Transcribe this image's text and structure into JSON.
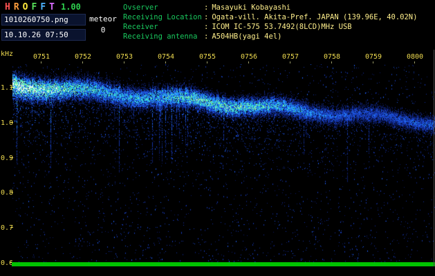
{
  "header": {
    "title": {
      "letters": [
        {
          "char": "H",
          "color": "#ff5252"
        },
        {
          "char": "R",
          "color": "#ff9e3d"
        },
        {
          "char": "O",
          "color": "#ffe93d"
        },
        {
          "char": "F",
          "color": "#57e05a"
        },
        {
          "char": "F",
          "color": "#4db2ff"
        },
        {
          "char": "T",
          "color": "#d86bff"
        }
      ],
      "version": "1.00",
      "version_color": "#2ed04e"
    },
    "filename": "1010260750.png",
    "meteor": {
      "label": "meteor",
      "count": "0"
    },
    "datetime": "10.10.26 07:50",
    "info": {
      "label_color": "#19c95e",
      "value_color": "#ffef8c",
      "separator": ":",
      "rows": [
        {
          "label": "Ovserver",
          "value": "Masayuki Kobayashi"
        },
        {
          "label": "Receiving Location",
          "value": "Ogata-vill. Akita-Pref. JAPAN (139.96E, 40.02N)"
        },
        {
          "label": "Receiver",
          "value": "ICOM IC-575 53.7492(8LCD)MHz USB"
        },
        {
          "label": "Receiving antenna",
          "value": "A504HB(yagi 4el)"
        }
      ]
    }
  },
  "spectrogram": {
    "freq_unit": "kHz",
    "time_ticks": [
      "0751",
      "0752",
      "0753",
      "0754",
      "0755",
      "0756",
      "0757",
      "0758",
      "0759",
      "0800"
    ],
    "freq_ticks": [
      "1.1",
      "1.0",
      "0.9",
      "0.8",
      "0.7",
      "0.6"
    ],
    "axis_color": "#f0dc50",
    "level_bar_color": "#00c300",
    "freq_top_khz": 1.165,
    "freq_bottom_khz": 0.6,
    "band": {
      "start_khz": 1.105,
      "end_khz": 1.0
    },
    "palette": [
      "#0c1c66",
      "#1534a8",
      "#1e5ae6",
      "#28a0ff",
      "#3ce8c8",
      "#8cf79a",
      "#eaffee"
    ],
    "seed": 20101026
  }
}
